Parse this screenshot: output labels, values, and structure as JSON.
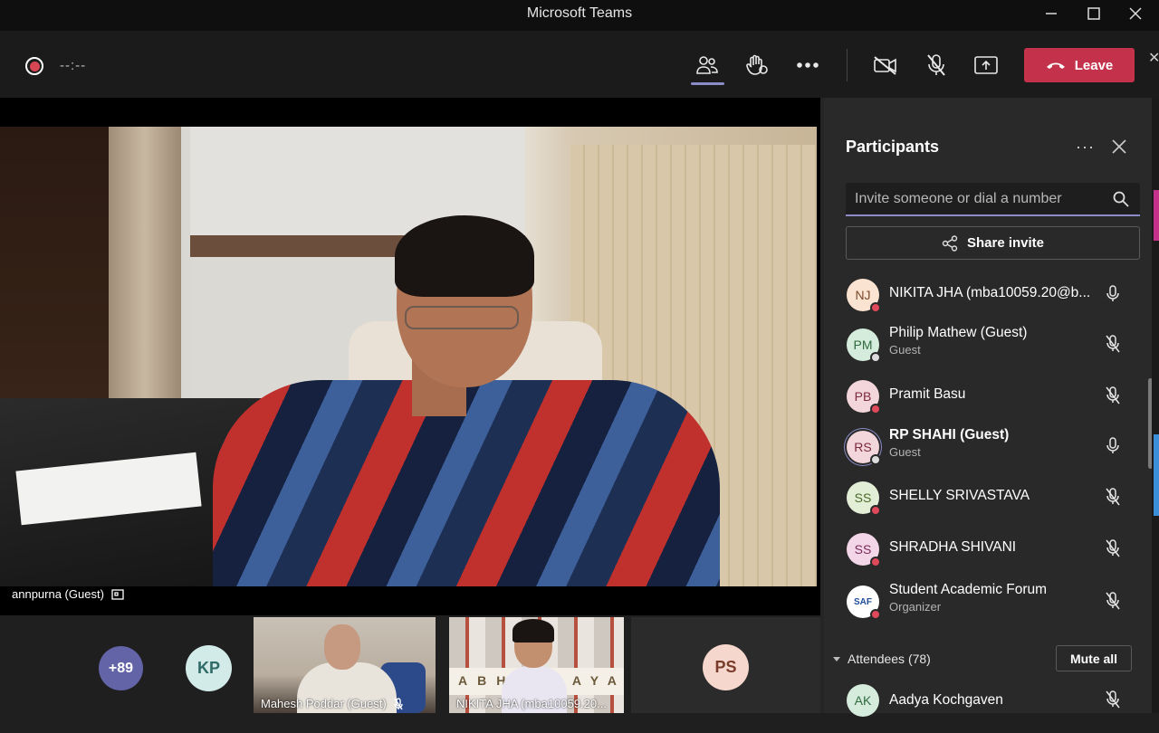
{
  "window": {
    "title": "Microsoft Teams"
  },
  "toolbar": {
    "timer": "--:--",
    "leave_label": "Leave",
    "icons": [
      "people-icon",
      "raise-hand-icon",
      "more-actions-icon",
      "camera-off-icon",
      "mic-off-icon",
      "share-screen-icon"
    ]
  },
  "stage": {
    "speaker_label": "annpurna (Guest)"
  },
  "gallery": {
    "overflow_count": "+89",
    "tiles": [
      {
        "initials": "KP"
      },
      {
        "label": "Mahesh Poddar (Guest)"
      },
      {
        "label": "NIKITA JHA (mba10059.20...",
        "banner": "ABHYUDAYA"
      },
      {
        "initials": "PS"
      }
    ]
  },
  "participants": {
    "title": "Participants",
    "search_placeholder": "Invite someone or dial a number",
    "share_invite_label": "Share invite",
    "people": [
      {
        "initials": "NJ",
        "name": "NIKITA JHA (mba10059.20@b...",
        "subtitle": "",
        "mic": "on",
        "status": "red",
        "av_bg": "#fbe3d2",
        "av_fg": "#7a4a2a"
      },
      {
        "initials": "PM",
        "name": "Philip Mathew (Guest)",
        "subtitle": "Guest",
        "mic": "off",
        "status": "gray",
        "av_bg": "#d5ecdc",
        "av_fg": "#2e6a3e"
      },
      {
        "initials": "PB",
        "name": "Pramit Basu",
        "subtitle": "",
        "mic": "off",
        "status": "red",
        "av_bg": "#f3d6dc",
        "av_fg": "#7a2a3a"
      },
      {
        "initials": "RS",
        "name": "RP SHAHI (Guest)",
        "subtitle": "Guest",
        "mic": "on",
        "status": "gray",
        "av_bg": "#f3d6dc",
        "av_fg": "#7a2a3a"
      },
      {
        "initials": "SS",
        "name": "SHELLY SRIVASTAVA",
        "subtitle": "",
        "mic": "off",
        "status": "red",
        "av_bg": "#e3eed7",
        "av_fg": "#4a6a2a"
      },
      {
        "initials": "SS",
        "name": "SHRADHA SHIVANI",
        "subtitle": "",
        "mic": "off",
        "status": "red",
        "av_bg": "#f3d6e8",
        "av_fg": "#7a2a5a"
      },
      {
        "initials": "SAF",
        "name": "Student Academic Forum",
        "subtitle": "Organizer",
        "mic": "off",
        "status": "red",
        "av_bg": "#ffffff",
        "av_fg": "#1f4f9a"
      }
    ],
    "attendees_label": "Attendees (78)",
    "mute_all_label": "Mute all",
    "attendee_first": {
      "initials": "AK",
      "name": "Aadya Kochgaven",
      "mic": "off",
      "av_bg": "#d5ecdc",
      "av_fg": "#2e6a3e"
    }
  },
  "colors": {
    "accent": "#8b8cc7",
    "leave": "#c4314b",
    "panel_bg": "#292929",
    "presence_red": "#e0495a"
  }
}
